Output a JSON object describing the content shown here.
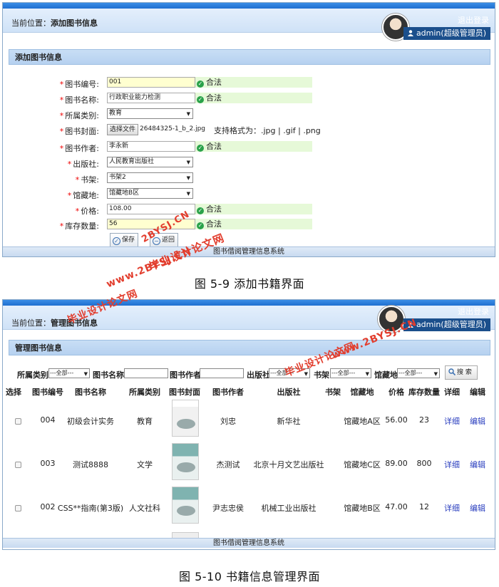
{
  "screen1": {
    "breadcrumb_prefix": "当前位置：",
    "breadcrumb_page": "添加图书信息",
    "logout": "退出登录",
    "user": "admin(超级管理员)",
    "panel_title": "添加图书信息",
    "fields": [
      {
        "label": "图书编号:",
        "value": "001",
        "status": "合法",
        "kind": "input",
        "highlight": true
      },
      {
        "label": "图书名称:",
        "value": "行政职业能力检测",
        "status": "合法",
        "kind": "input",
        "highlight": false
      },
      {
        "label": "所属类别:",
        "value": "教育",
        "kind": "select"
      },
      {
        "label": "图书封面:",
        "kind": "file"
      },
      {
        "label": "图书作者:",
        "value": "李永新",
        "status": "合法",
        "kind": "input",
        "highlight": false
      },
      {
        "label": "出版社:",
        "value": "人民教育出版社",
        "kind": "select"
      },
      {
        "label": "书架:",
        "value": "书架2",
        "kind": "select"
      },
      {
        "label": "馆藏地:",
        "value": "馆藏地B区",
        "kind": "select"
      },
      {
        "label": "价格:",
        "value": "108.00",
        "status": "合法",
        "kind": "input",
        "highlight": false
      },
      {
        "label": "库存数量:",
        "value": "56",
        "status": "合法",
        "kind": "input",
        "highlight": true
      }
    ],
    "file_button": "选择文件",
    "file_name": "26484325-1_b_2.jpg",
    "file_hint": "支持格式为：.jpg | .gif | .png",
    "save_button": "保存",
    "back_button": "返回",
    "footer": "图书借阅管理信息系统"
  },
  "caption1": "图 5-9 添加书籍界面",
  "screen2": {
    "breadcrumb_prefix": "当前位置：",
    "breadcrumb_page": "管理图书信息",
    "logout": "退出登录",
    "user": "admin(超级管理员)",
    "panel_title": "管理图书信息",
    "filters": {
      "category_label": "所属类别",
      "category_value": "---全部---",
      "name_label": "图书名称:",
      "author_label": "图书作者:",
      "publisher_label": "出版社:",
      "publisher_value": "---全部---",
      "shelf_label": "书架:",
      "shelf_value": "---全部---",
      "location_label": "馆藏地:",
      "location_value": "---全部---",
      "search_button": "搜 索"
    },
    "columns": [
      "选择",
      "图书编号",
      "图书名称",
      "所属类别",
      "图书封面",
      "图书作者",
      "出版社",
      "书架",
      "馆藏地",
      "价格",
      "库存数量",
      "详细",
      "编辑"
    ],
    "rows": [
      {
        "id": "004",
        "name": "初级会计实务",
        "category": "教育",
        "author": "刘忠",
        "publisher": "新华社",
        "shelf": "",
        "location": "馆藏地A区",
        "price": "56.00",
        "stock": "23",
        "detail": "详细",
        "edit": "编辑"
      },
      {
        "id": "003",
        "name": "测试8888",
        "category": "文学",
        "author": "杰测试",
        "publisher": "北京十月文艺出版社",
        "shelf": "",
        "location": "馆藏地C区",
        "price": "89.00",
        "stock": "800",
        "detail": "详细",
        "edit": "编辑"
      },
      {
        "id": "002",
        "name": "CSS**指南(第3版)",
        "category": "人文社科",
        "author": "尹志忠侯",
        "publisher": "机械工业出版社",
        "shelf": "",
        "location": "馆藏地B区",
        "price": "47.00",
        "stock": "12",
        "detail": "详细",
        "edit": "编辑"
      }
    ],
    "footer": "图书借阅管理信息系统"
  },
  "caption2": "图 5-10 书籍信息管理界面",
  "watermark": {
    "text_cn": "毕业设计论文网",
    "text_url1": "www.2BYSJ.CN",
    "text_url2": "2BYSJ.CN",
    "color": "#e23d2d"
  }
}
